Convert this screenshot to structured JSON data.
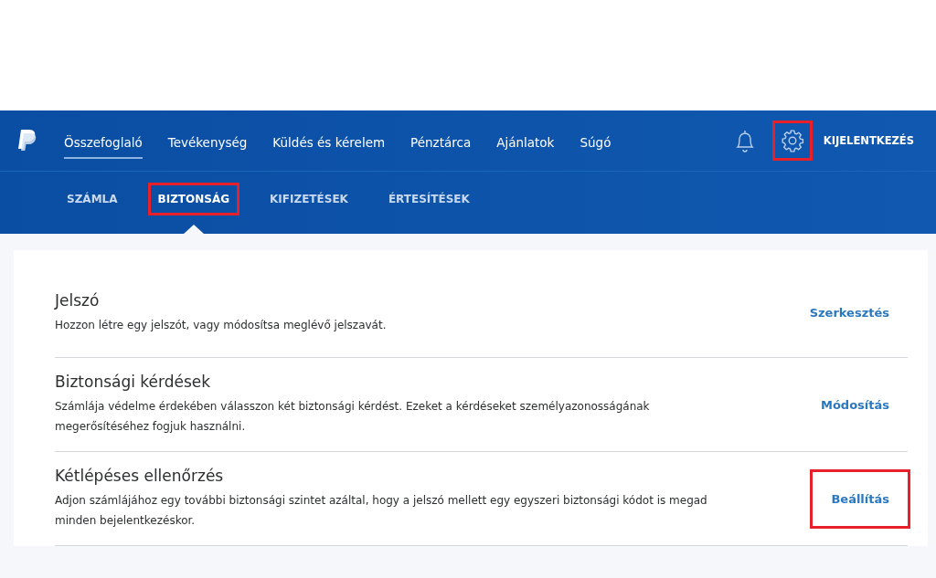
{
  "nav": {
    "items": [
      {
        "label": "Összefoglaló",
        "selected": true
      },
      {
        "label": "Tevékenység",
        "selected": false
      },
      {
        "label": "Küldés és kérelem",
        "selected": false
      },
      {
        "label": "Pénztárca",
        "selected": false
      },
      {
        "label": "Ajánlatok",
        "selected": false
      },
      {
        "label": "Súgó",
        "selected": false
      }
    ],
    "settings_highlighted": true,
    "logout": "KIJELENTKEZÉS"
  },
  "subnav": {
    "tabs": [
      {
        "label": "SZÁMLA",
        "selected": false,
        "highlighted": false
      },
      {
        "label": "BIZTONSÁG",
        "selected": true,
        "highlighted": true
      },
      {
        "label": "KIFIZETÉSEK",
        "selected": false,
        "highlighted": false
      },
      {
        "label": "ÉRTESÍTÉSEK",
        "selected": false,
        "highlighted": false
      }
    ]
  },
  "settings": [
    {
      "title": "Jelszó",
      "description": "Hozzon létre egy jelszót, vagy módosítsa meglévő jelszavát.",
      "action": "Szerkesztés",
      "highlighted": false
    },
    {
      "title": "Biztonsági kérdések",
      "description": "Számlája védelme érdekében válasszon két biztonsági kérdést. Ezeket a kérdéseket személyazonosságának megerősítéséhez fogjuk használni.",
      "action": "Módosítás",
      "highlighted": false
    },
    {
      "title": "Kétlépéses ellenőrzés",
      "description": "Adjon számlájához egy további biztonsági szintet azáltal, hogy a jelszó mellett egy egyszeri biztonsági kódot is megad minden bejelentkezéskor.",
      "action": "Beállítás",
      "highlighted": true
    }
  ]
}
